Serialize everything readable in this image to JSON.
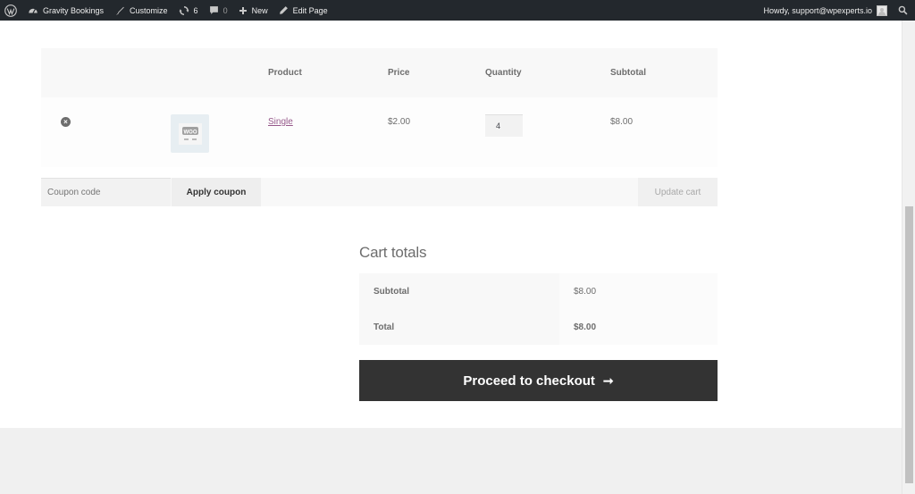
{
  "admin_bar": {
    "site_name": "Gravity Bookings",
    "customize": "Customize",
    "updates_count": "6",
    "comments_count": "0",
    "new_label": "New",
    "edit_page": "Edit Page",
    "howdy": "Howdy, support@wpexperts.io"
  },
  "cart_table": {
    "headers": {
      "product": "Product",
      "price": "Price",
      "quantity": "Quantity",
      "subtotal": "Subtotal"
    },
    "rows": [
      {
        "product": "Single",
        "price": "$2.00",
        "quantity": "4",
        "subtotal": "$8.00",
        "thumb_text": "WOO"
      }
    ]
  },
  "actions": {
    "coupon_placeholder": "Coupon code",
    "apply_coupon": "Apply coupon",
    "update_cart": "Update cart"
  },
  "cart_totals": {
    "title": "Cart totals",
    "subtotal_label": "Subtotal",
    "subtotal_value": "$8.00",
    "total_label": "Total",
    "total_value": "$8.00"
  },
  "checkout": {
    "label": "Proceed to checkout",
    "arrow": "➞"
  },
  "colors": {
    "admin_bar": "#23282d",
    "link": "#96588a",
    "button_dark": "#333333"
  }
}
